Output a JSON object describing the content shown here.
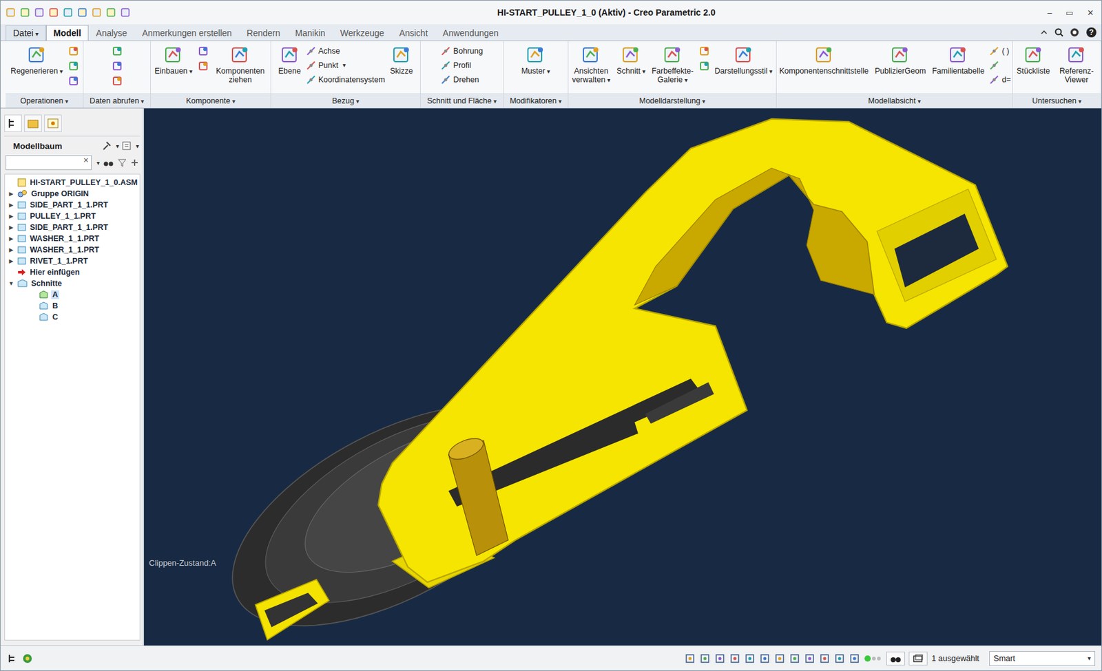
{
  "window": {
    "title": "HI-START_PULLEY_1_0 (Aktiv) - Creo Parametric 2.0",
    "controls": [
      "–",
      "▭",
      "✕"
    ]
  },
  "dropdown_glyph": "▾",
  "help_glyph": "?",
  "menu_tabs": [
    {
      "label": "Datei",
      "selected": false,
      "dropdown": true
    },
    {
      "label": "Modell",
      "selected": true,
      "dropdown": false
    },
    {
      "label": "Analyse",
      "selected": false,
      "dropdown": false
    },
    {
      "label": "Anmerkungen erstellen",
      "selected": false,
      "dropdown": false
    },
    {
      "label": "Rendern",
      "selected": false,
      "dropdown": false
    },
    {
      "label": "Manikin",
      "selected": false,
      "dropdown": false
    },
    {
      "label": "Werkzeuge",
      "selected": false,
      "dropdown": false
    },
    {
      "label": "Ansicht",
      "selected": false,
      "dropdown": false
    },
    {
      "label": "Anwendungen",
      "selected": false,
      "dropdown": false
    }
  ],
  "ribbon": [
    {
      "label": "Operationen",
      "columns": [
        {
          "kind": "large",
          "label": "Regenerieren",
          "dropdown": true
        },
        {
          "kind": "icons",
          "count": 3
        }
      ]
    },
    {
      "label": "Daten abrufen",
      "columns": [
        {
          "kind": "icons",
          "count": 3
        }
      ]
    },
    {
      "label": "Komponente",
      "columns": [
        {
          "kind": "large",
          "label": "Einbauen",
          "dropdown": true
        },
        {
          "kind": "icons",
          "count": 2
        },
        {
          "kind": "large",
          "label": "Komponenten ziehen",
          "dropdown": false
        }
      ]
    },
    {
      "label": "Bezug",
      "columns": [
        {
          "kind": "large",
          "label": "Ebene",
          "dropdown": false
        },
        {
          "kind": "small",
          "items": [
            {
              "label": "Achse",
              "dropdown": false
            },
            {
              "label": "Punkt",
              "dropdown": true
            },
            {
              "label": "Koordinatensystem",
              "dropdown": false
            }
          ]
        },
        {
          "kind": "large",
          "label": "Skizze",
          "dropdown": false
        }
      ]
    },
    {
      "label": "Schnitt und Fläche",
      "columns": [
        {
          "kind": "small",
          "items": [
            {
              "label": "Bohrung",
              "dropdown": false
            },
            {
              "label": "Profil",
              "dropdown": false
            },
            {
              "label": "Drehen",
              "dropdown": false
            }
          ]
        }
      ]
    },
    {
      "label": "Modifikatoren",
      "columns": [
        {
          "kind": "large",
          "label": "Muster",
          "dropdown": true
        }
      ]
    },
    {
      "label": "Modelldarstellung",
      "columns": [
        {
          "kind": "large",
          "label": "Ansichten verwalten",
          "dropdown": true
        },
        {
          "kind": "large",
          "label": "Schnitt",
          "dropdown": true
        },
        {
          "kind": "large",
          "label": "Farbeffekte-Galerie",
          "dropdown": true
        },
        {
          "kind": "icons",
          "count": 2
        },
        {
          "kind": "large",
          "label": "Darstellungsstil",
          "dropdown": true
        }
      ]
    },
    {
      "label": "Modellabsicht",
      "columns": [
        {
          "kind": "large",
          "label": "Komponentenschnittstelle",
          "dropdown": false
        },
        {
          "kind": "large",
          "label": "PublizierGeom",
          "dropdown": false
        },
        {
          "kind": "large",
          "label": "Familientabelle",
          "dropdown": false
        },
        {
          "kind": "small",
          "items": [
            {
              "label": "( )",
              "dropdown": false
            },
            {
              "label": "",
              "dropdown": false
            },
            {
              "label": "d=",
              "dropdown": false
            }
          ]
        }
      ]
    },
    {
      "label": "Untersuchen",
      "columns": [
        {
          "kind": "large",
          "label": "Stückliste",
          "dropdown": false
        },
        {
          "kind": "large",
          "label": "Referenz-Viewer",
          "dropdown": false
        }
      ]
    }
  ],
  "model_tree": {
    "title": "Modellbaum",
    "clear": "×",
    "items": [
      {
        "label": "HI-START_PULLEY_1_0.ASM",
        "level": 0,
        "kind": "assembly",
        "selected": false
      },
      {
        "label": "Gruppe ORIGIN",
        "level": 0,
        "kind": "group",
        "toggle": "▶",
        "expanded": false,
        "selected": false
      },
      {
        "label": "SIDE_PART_1_1.PRT",
        "level": 0,
        "kind": "part",
        "toggle": "▶",
        "expanded": false,
        "selected": false
      },
      {
        "label": "PULLEY_1_1.PRT",
        "level": 0,
        "kind": "part",
        "toggle": "▶",
        "expanded": false,
        "selected": false
      },
      {
        "label": "SIDE_PART_1_1.PRT",
        "level": 0,
        "kind": "part",
        "toggle": "▶",
        "expanded": false,
        "selected": false
      },
      {
        "label": "WASHER_1_1.PRT",
        "level": 0,
        "kind": "part",
        "toggle": "▶",
        "expanded": false,
        "selected": false
      },
      {
        "label": "WASHER_1_1.PRT",
        "level": 0,
        "kind": "part",
        "toggle": "▶",
        "expanded": false,
        "selected": false
      },
      {
        "label": "RIVET_1_1.PRT",
        "level": 0,
        "kind": "part",
        "toggle": "▶",
        "expanded": false,
        "selected": false
      },
      {
        "label": "Hier einfügen",
        "level": 0,
        "kind": "insert",
        "selected": false
      },
      {
        "label": "Schnitte",
        "level": 0,
        "kind": "folder",
        "toggle": "▼",
        "expanded": true,
        "selected": false
      },
      {
        "label": "A",
        "level": 1,
        "kind": "section",
        "selected": true
      },
      {
        "label": "B",
        "level": 1,
        "kind": "section",
        "selected": false
      },
      {
        "label": "C",
        "level": 1,
        "kind": "section",
        "selected": false
      }
    ]
  },
  "viewport": {
    "clip_label": "Clippen-Zustand:A"
  },
  "status_bar": {
    "selection": "1 ausgewählt",
    "filter": "Smart"
  }
}
